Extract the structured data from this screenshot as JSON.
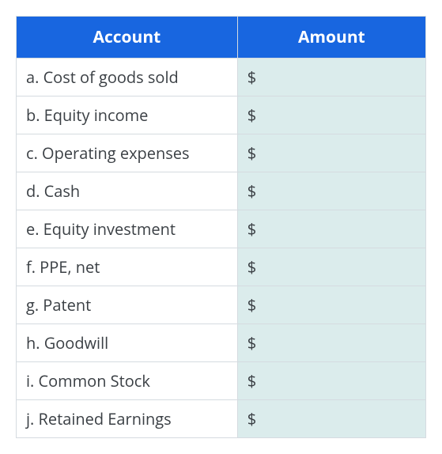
{
  "table": {
    "headers": {
      "account": "Account",
      "amount": "Amount"
    },
    "rows": [
      {
        "account": "a. Cost of goods sold",
        "amount": "$"
      },
      {
        "account": "b. Equity income",
        "amount": "$"
      },
      {
        "account": "c. Operating expenses",
        "amount": "$"
      },
      {
        "account": "d. Cash",
        "amount": "$"
      },
      {
        "account": "e. Equity investment",
        "amount": "$"
      },
      {
        "account": "f. PPE, net",
        "amount": "$"
      },
      {
        "account": "g. Patent",
        "amount": "$"
      },
      {
        "account": "h. Goodwill",
        "amount": "$"
      },
      {
        "account": "i. Common Stock",
        "amount": "$"
      },
      {
        "account": "j. Retained Earnings",
        "amount": "$"
      }
    ]
  },
  "colors": {
    "headerBg": "#1866e0",
    "headerText": "#ffffff",
    "amountBg": "#dbecec",
    "border": "#d5dbe0",
    "text": "#3a3f44"
  }
}
